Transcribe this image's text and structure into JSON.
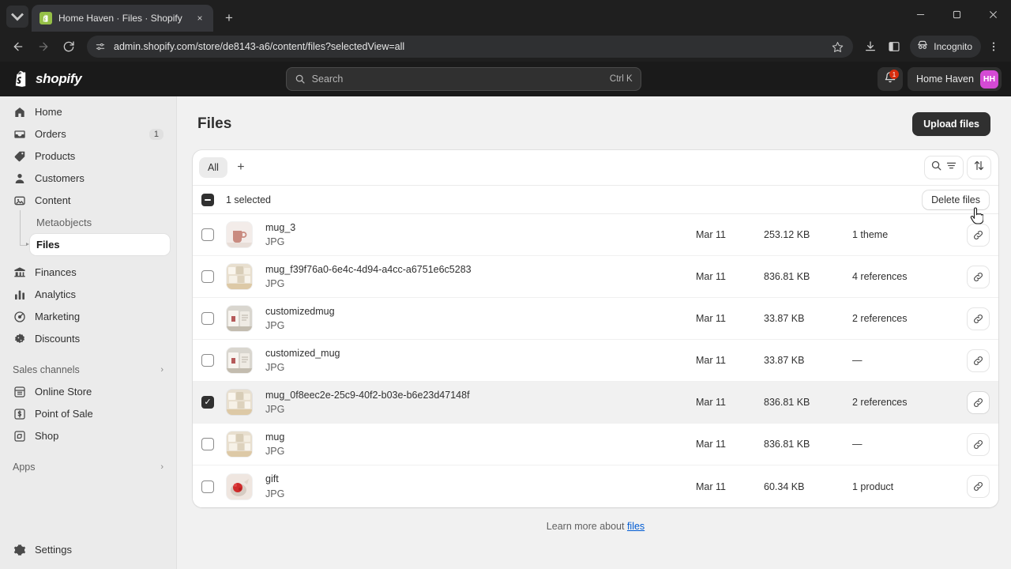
{
  "browser": {
    "tab": {
      "title": "Home Haven · Files · Shopify",
      "favicon": "shopify-icon",
      "close": "×",
      "newtab": "+"
    },
    "url": "admin.shopify.com/store/de8143-a6/content/files?selectedView=all",
    "incognito_label": "Incognito",
    "icons": {
      "tab_list": "chevron-down-icon",
      "back": "back-arrow-icon",
      "forward": "forward-arrow-icon",
      "reload": "reload-icon",
      "site_settings": "page-settings-icon",
      "bookmark": "star-icon",
      "downloads": "download-icon",
      "sidepanel": "side-panel-icon",
      "incognito": "incognito-icon",
      "menu": "kebab-menu-icon",
      "minimize": "minimize-icon",
      "maximize": "maximize-icon",
      "close": "close-icon"
    }
  },
  "topbar": {
    "brand": "shopify",
    "search": {
      "placeholder": "Search",
      "shortcut": "Ctrl K",
      "icon": "search-icon"
    },
    "notifications": {
      "icon": "bell-icon",
      "count": "1"
    },
    "store": {
      "name": "Home Haven",
      "initials": "HH",
      "avatar_color": "#d44ad4"
    }
  },
  "sidebar": {
    "items": [
      {
        "label": "Home",
        "icon": "home-icon",
        "badge": null,
        "active": false
      },
      {
        "label": "Orders",
        "icon": "orders-icon",
        "badge": "1",
        "active": false
      },
      {
        "label": "Products",
        "icon": "products-tag-icon",
        "badge": null,
        "active": false
      },
      {
        "label": "Customers",
        "icon": "customers-person-icon",
        "badge": null,
        "active": false
      },
      {
        "label": "Content",
        "icon": "content-image-icon",
        "badge": null,
        "active": false
      }
    ],
    "content_children": [
      {
        "label": "Metaobjects",
        "active": false
      },
      {
        "label": "Files",
        "active": true
      }
    ],
    "items_after": [
      {
        "label": "Finances",
        "icon": "finances-bank-icon",
        "badge": null,
        "active": false
      },
      {
        "label": "Analytics",
        "icon": "analytics-bars-icon",
        "badge": null,
        "active": false
      },
      {
        "label": "Marketing",
        "icon": "marketing-megaphone-icon",
        "badge": null,
        "active": false
      },
      {
        "label": "Discounts",
        "icon": "discounts-badge-icon",
        "badge": null,
        "active": false
      }
    ],
    "sales_channels": {
      "label": "Sales channels",
      "chevron": "›",
      "items": [
        {
          "label": "Online Store",
          "icon": "online-store-icon"
        },
        {
          "label": "Point of Sale",
          "icon": "point-of-sale-icon"
        },
        {
          "label": "Shop",
          "icon": "shop-icon"
        }
      ]
    },
    "apps": {
      "label": "Apps",
      "chevron": "›"
    },
    "settings": {
      "label": "Settings",
      "icon": "gear-icon"
    }
  },
  "page": {
    "title": "Files",
    "upload_button": "Upload files",
    "tabs": [
      {
        "label": "All",
        "active": true
      }
    ],
    "add_tab": "+",
    "tools": {
      "search_filter": "search-filter-icon",
      "sort": "sort-icon"
    },
    "selection": {
      "count_label": "1 selected",
      "delete_button": "Delete files"
    },
    "footnote": {
      "prefix": "Learn more about ",
      "link": "files"
    }
  },
  "files": [
    {
      "name": "mug_3",
      "type": "JPG",
      "date": "Mar 11",
      "size": "253.12 KB",
      "refs": "1 theme",
      "selected": false,
      "thumb": "pink-mug"
    },
    {
      "name": "mug_f39f76a0-6e4c-4d94-a4cc-a6751e6c5283",
      "type": "JPG",
      "date": "Mar 11",
      "size": "836.81 KB",
      "refs": "4 references",
      "selected": false,
      "thumb": "mug-collection"
    },
    {
      "name": "customizedmug",
      "type": "JPG",
      "date": "Mar 11",
      "size": "33.87 KB",
      "refs": "2 references",
      "selected": false,
      "thumb": "customized-mug"
    },
    {
      "name": "customized_mug",
      "type": "JPG",
      "date": "Mar 11",
      "size": "33.87 KB",
      "refs": "—",
      "selected": false,
      "thumb": "customized-mug"
    },
    {
      "name": "mug_0f8eec2e-25c9-40f2-b03e-b6e23d47148f",
      "type": "JPG",
      "date": "Mar 11",
      "size": "836.81 KB",
      "refs": "2 references",
      "selected": true,
      "thumb": "mug-collection"
    },
    {
      "name": "mug",
      "type": "JPG",
      "date": "Mar 11",
      "size": "836.81 KB",
      "refs": "—",
      "selected": false,
      "thumb": "mug-collection"
    },
    {
      "name": "gift",
      "type": "JPG",
      "date": "Mar 11",
      "size": "60.34 KB",
      "refs": "1 product",
      "selected": false,
      "thumb": "gift-red"
    }
  ]
}
